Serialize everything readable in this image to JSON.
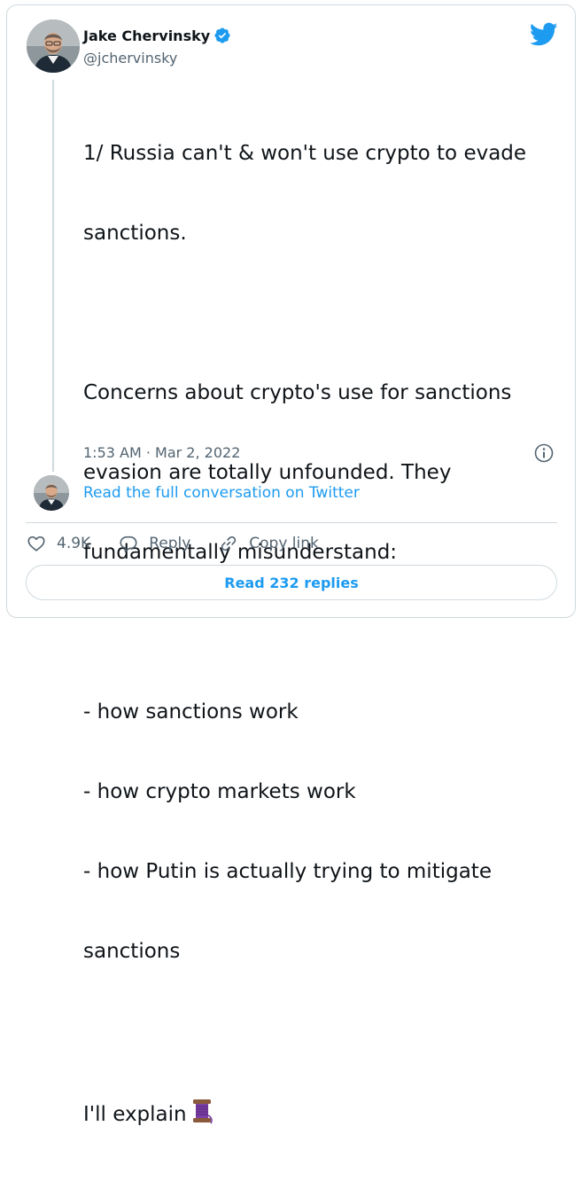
{
  "author": {
    "display_name": "Jake Chervinsky",
    "handle": "@jchervinsky",
    "verified": true
  },
  "tweet": {
    "lines": [
      "1/ Russia can't & won't use crypto to evade",
      "sanctions.",
      "",
      "Concerns about crypto's use for sanctions",
      "evasion are totally unfounded. They",
      "fundamentally misunderstand:",
      "",
      "- how sanctions work",
      "- how crypto markets work",
      "- how Putin is actually trying to mitigate",
      "sanctions",
      "",
      "I'll explain"
    ],
    "timestamp": "1:53 AM · Mar 2, 2022"
  },
  "conversation": {
    "read_full_label": "Read the full conversation on Twitter"
  },
  "actions": {
    "like_count": "4.9K",
    "reply_label": "Reply",
    "copy_link_label": "Copy link"
  },
  "replies_button": {
    "label": "Read 232 replies"
  },
  "icons": {
    "brand": "twitter-bird-icon",
    "verified": "verified-badge-icon",
    "info": "info-icon",
    "like": "heart-icon",
    "reply": "speech-bubble-icon",
    "copy_link": "link-icon",
    "thread_emoji": "thread-spool-icon"
  },
  "colors": {
    "accent": "#1d9bf0",
    "text_primary": "#0f1419",
    "text_secondary": "#536471",
    "border": "#cfd9de"
  }
}
